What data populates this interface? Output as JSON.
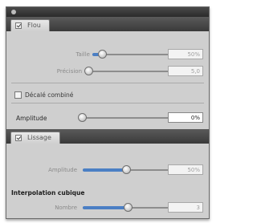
{
  "flou": {
    "tab_label": "Flou",
    "taille_label": "Taille",
    "taille_value": "50%",
    "taille_level": 0.12,
    "precision_label": "Précision",
    "precision_value": "5,0",
    "precision_level": 0.04,
    "discontinu_label": "Décalé combiné",
    "amplitude_label": "Amplitude",
    "amplitude_value": "0%",
    "amplitude_level": 0.03
  },
  "lissage": {
    "tab_label": "Lissage",
    "amplitude_label": "Amplitude",
    "amplitude_value": "50%",
    "amplitude_level": 0.48,
    "interpolation_label": "Interpolation cubique",
    "nombre_label": "Nombre",
    "nombre_value": "3",
    "nombre_level": 0.5
  },
  "colors": {
    "accent": "#4b7fc4",
    "panel": "#cfcfcf",
    "header": "#3a3a3a"
  }
}
